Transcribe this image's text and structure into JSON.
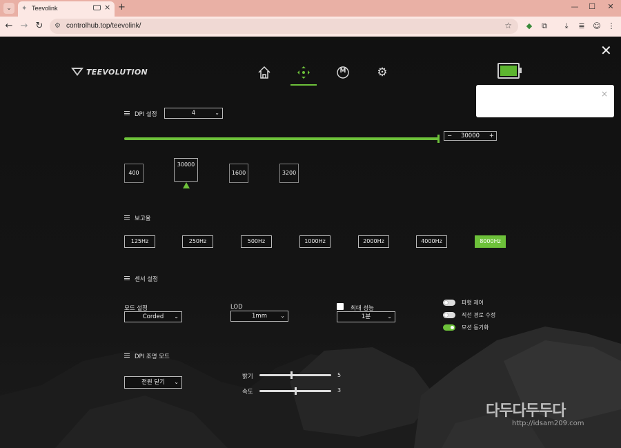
{
  "browser": {
    "tab_menu_glyph": "⌄",
    "tab_title": "Teevolink",
    "tab_close": "×",
    "new_tab": "+",
    "window_min": "—",
    "window_max": "☐",
    "window_close": "✕",
    "url": "controlhub.top/teevolink/",
    "back": "←",
    "forward": "→",
    "reload": "↻",
    "star": "☆",
    "menu": "⋮"
  },
  "app": {
    "close_glyph": "✕",
    "brand": "TEEVOLUTION",
    "accent": "#6dc13a",
    "battery_color": "#5db530",
    "popup_close": "×",
    "nav_icons": [
      "home-icon",
      "move-icon",
      "macro-icon",
      "gear-icon"
    ],
    "nav_macro_letter": "M"
  },
  "dpi": {
    "title": "DPI 설정",
    "profile_value": "4",
    "value": "30000",
    "minus": "−",
    "plus": "+",
    "slider_fraction": 1.0,
    "presets": [
      "400",
      "30000",
      "1600",
      "3200"
    ],
    "active_preset": "30000"
  },
  "report_rate": {
    "title": "보고율",
    "options": [
      "125Hz",
      "250Hz",
      "500Hz",
      "1000Hz",
      "2000Hz",
      "4000Hz",
      "8000Hz"
    ],
    "active": "8000Hz"
  },
  "sensor": {
    "title": "센서 설정",
    "mode_label": "모드 설정",
    "mode_value": "Corded",
    "lod_label": "LOD",
    "lod_value": "1mm",
    "max_perf_label": "최대 성능",
    "max_perf_value": "1분",
    "toggles": [
      {
        "label": "파형 제어",
        "on": false
      },
      {
        "label": "직선 경로 수정",
        "on": false
      },
      {
        "label": "모션 동기화",
        "on": true
      }
    ]
  },
  "lighting": {
    "title": "DPI 조명 모드",
    "mode_value": "전원 닫기",
    "brightness_label": "밝기",
    "brightness_value": "5",
    "brightness_fraction": 0.45,
    "speed_label": "속도",
    "speed_value": "3",
    "speed_fraction": 0.5
  },
  "watermark": {
    "title": "다두다두두다",
    "url": "http://idsam209.com"
  },
  "caret": "⌄"
}
